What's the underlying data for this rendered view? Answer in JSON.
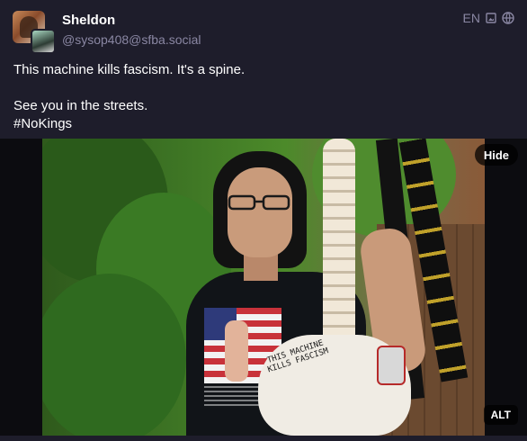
{
  "post": {
    "author": {
      "display_name": "Sheldon",
      "account": "@sysop408@sfba.social",
      "avatar_icon": "avatar-image"
    },
    "meta": {
      "language": "EN",
      "icons": [
        "media-attachment-icon",
        "globe-icon"
      ]
    },
    "content": {
      "line1": "This machine kills fascism. It's a spine.",
      "line2": "See you in the streets.",
      "hashtag": "#NoKings"
    },
    "media": {
      "hide_label": "Hide",
      "alt_label": "ALT",
      "pelvis_text": "THIS MACHINE KILLS FASCISM",
      "description_icon": "photo"
    }
  },
  "colors": {
    "background": "#1e1d2b",
    "muted_text": "#8a87a3",
    "text": "#ffffff"
  }
}
